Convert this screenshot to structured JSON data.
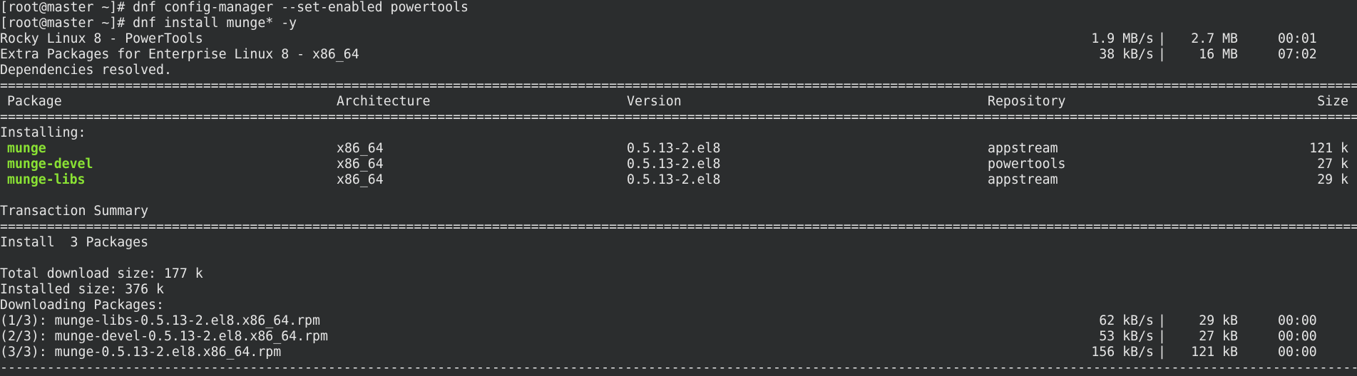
{
  "terminal": {
    "prompt_1": "[root@master ~]# dnf config-manager --set-enabled powertools",
    "prompt_2": "[root@master ~]# dnf install munge* -y",
    "repos": [
      {
        "name": "Rocky Linux 8 - PowerTools",
        "speed": "1.9 MB/s",
        "size": "2.7 MB",
        "time": "00:01"
      },
      {
        "name": "Extra Packages for Enterprise Linux 8 - x86_64",
        "speed": "38 kB/s",
        "size": "16 MB",
        "time": "07:02"
      }
    ],
    "deps_resolved": "Dependencies resolved.",
    "separator_double": "================================================================================================================================================================================================",
    "separator_single": "------------------------------------------------------------------------------------------------------------------------------------------------------------------------------------------------",
    "table": {
      "headers": {
        "package": "Package",
        "arch": "Architecture",
        "version": "Version",
        "repository": "Repository",
        "size": "Size"
      },
      "section": "Installing:",
      "rows": [
        {
          "package": "munge",
          "arch": "x86_64",
          "version": "0.5.13-2.el8",
          "repository": "appstream",
          "size": "121 k"
        },
        {
          "package": "munge-devel",
          "arch": "x86_64",
          "version": "0.5.13-2.el8",
          "repository": "powertools",
          "size": "27 k"
        },
        {
          "package": "munge-libs",
          "arch": "x86_64",
          "version": "0.5.13-2.el8",
          "repository": "appstream",
          "size": "29 k"
        }
      ]
    },
    "summary_title": "Transaction Summary",
    "install_count": "Install  3 Packages",
    "total_download": "Total download size: 177 k",
    "installed_size": "Installed size: 376 k",
    "downloading": "Downloading Packages:",
    "downloads": [
      {
        "file": "(1/3): munge-libs-0.5.13-2.el8.x86_64.rpm",
        "speed": "62 kB/s",
        "size": "29 kB",
        "time": "00:00"
      },
      {
        "file": "(2/3): munge-devel-0.5.13-2.el8.x86_64.rpm",
        "speed": "53 kB/s",
        "size": "27 kB",
        "time": "00:00"
      },
      {
        "file": "(3/3): munge-0.5.13-2.el8.x86_64.rpm",
        "speed": "156 kB/s",
        "size": "121 kB",
        "time": "00:00"
      }
    ]
  }
}
